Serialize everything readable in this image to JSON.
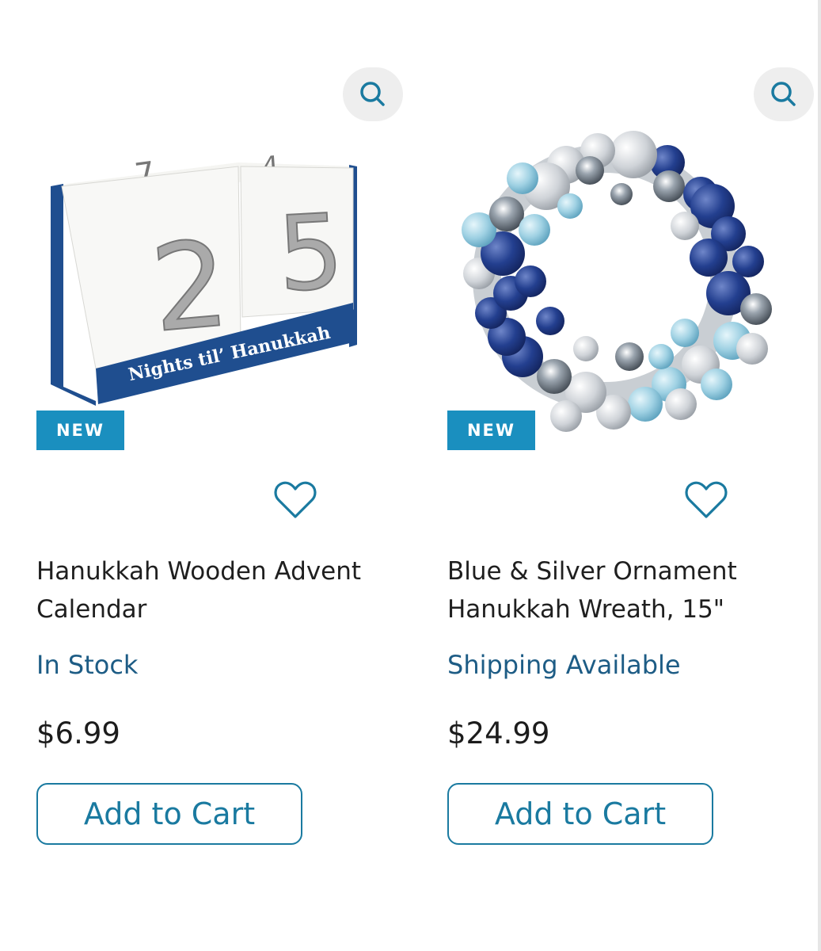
{
  "colors": {
    "accent": "#1a7aa0",
    "badge": "#1a8fbf",
    "availability": "#1d5c85",
    "text": "#1f1f1f"
  },
  "icons": {
    "zoom": "search-icon",
    "wishlist": "heart-icon"
  },
  "products": [
    {
      "badge": "NEW",
      "name": "Hanukkah Wooden Advent Calendar",
      "availability": "In Stock",
      "price": "$6.99",
      "add_to_cart_label": "Add to Cart",
      "image": {
        "front_digits": [
          "2",
          "5"
        ],
        "top_digits": [
          "7",
          "4"
        ],
        "banner_text": "Nights til’ Hanukkah"
      }
    },
    {
      "badge": "NEW",
      "name": "Blue & Silver Ornament Hanukkah Wreath, 15\"",
      "availability": "Shipping Available",
      "price": "$24.99",
      "add_to_cart_label": "Add to Cart"
    }
  ]
}
